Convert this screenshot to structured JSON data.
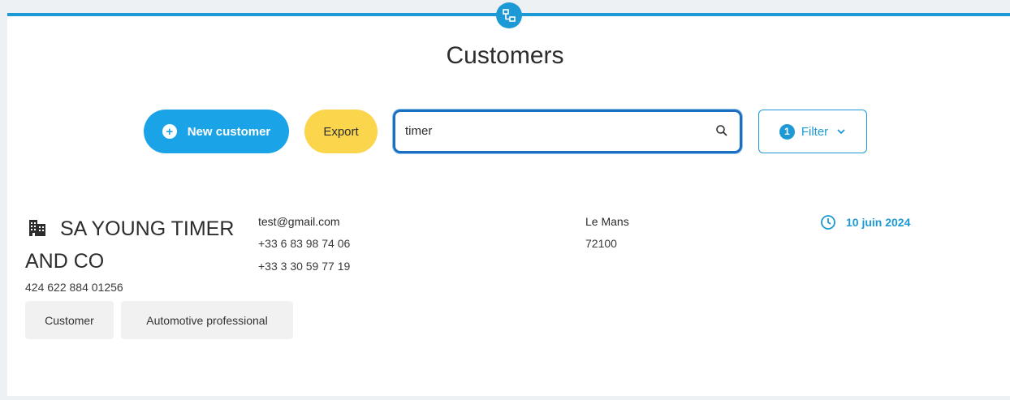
{
  "header": {
    "title": "Customers"
  },
  "toolbar": {
    "new_customer_label": "New customer",
    "export_label": "Export",
    "search_value": "timer",
    "filter_label": "Filter",
    "filter_count": "1"
  },
  "customer": {
    "name": "SA YOUNG TIMER AND CO",
    "siret": "424 622 884 01256",
    "tags": [
      "Customer",
      "Automotive professional"
    ],
    "email": "test@gmail.com",
    "phone1": "+33 6 83 98 74 06",
    "phone2": "+33 3 30 59 77 19",
    "city": "Le Mans",
    "zip": "72100",
    "date": "10 juin 2024"
  },
  "colors": {
    "accent": "#1d9ad6",
    "primary_button": "#1ba3e8",
    "export_button": "#fbd54b",
    "search_border": "#1a6fc0"
  },
  "icons": {
    "top_badge": "network-icon",
    "new_customer": "plus-circle-icon",
    "search": "search-icon",
    "filter": "chevron-down-icon",
    "company": "building-icon",
    "date": "clock-icon"
  }
}
